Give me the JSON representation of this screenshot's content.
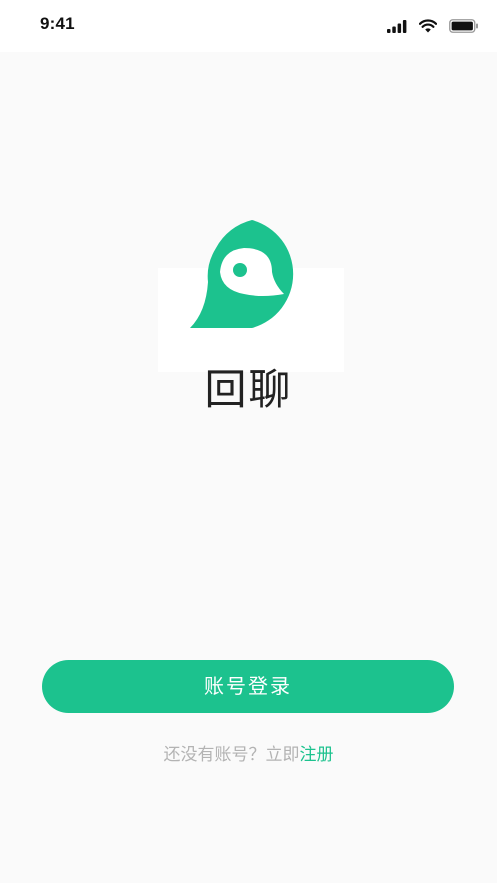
{
  "status_bar": {
    "time": "9:41",
    "icons": [
      "cellular-signal-icon",
      "wifi-icon",
      "battery-icon"
    ]
  },
  "app": {
    "name": "回聊",
    "logo_icon": "chat-bubble-logo-icon",
    "brand_color": "#1cc28e"
  },
  "actions": {
    "login_label": "账号登录"
  },
  "register": {
    "prompt": "还没有账号？立即",
    "link_label": "注册"
  },
  "colors": {
    "background": "#fafafa",
    "primary": "#1cc28e",
    "muted_text": "#b3b3b3",
    "title_text": "#222222"
  }
}
